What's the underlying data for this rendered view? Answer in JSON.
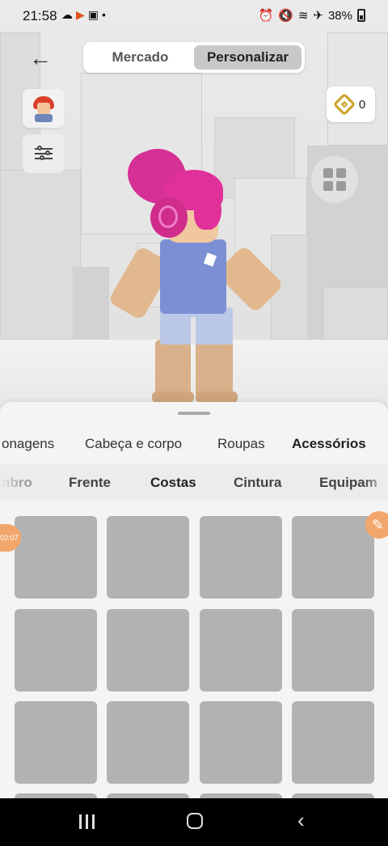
{
  "status": {
    "time": "21:58",
    "left_icons": [
      "cloud-icon",
      "video-icon",
      "image-icon",
      "dot-icon"
    ],
    "right_icons": [
      "alarm-icon",
      "mute-icon",
      "wifi-icon",
      "airplane-icon"
    ],
    "battery": "38%"
  },
  "header": {
    "back_label": "←",
    "segments": [
      {
        "label": "Mercado",
        "active": false
      },
      {
        "label": "Personalizar",
        "active": true
      }
    ]
  },
  "robux": {
    "count": "0"
  },
  "tabs": [
    {
      "label": "onagens",
      "active": false
    },
    {
      "label": "Cabeça e corpo",
      "active": false
    },
    {
      "label": "Roupas",
      "active": false
    },
    {
      "label": "Acessórios",
      "active": true
    }
  ],
  "subtabs": [
    {
      "label": "nbro",
      "active": false
    },
    {
      "label": "Frente",
      "active": false
    },
    {
      "label": "Costas",
      "active": true
    },
    {
      "label": "Cintura",
      "active": false
    },
    {
      "label": "Equipam",
      "active": false
    }
  ],
  "timer_badge": "02:07",
  "edit_icon": "brush-icon",
  "grid": {
    "rows": 3,
    "columns": 4,
    "item_state": "loading-placeholder"
  },
  "colors": {
    "tile": "#b2b2b2",
    "accent_orange": "#f3a66c",
    "hair_pink": "#e0309a",
    "shirt_blue": "#7d8fd4",
    "robux_gold": "#c9a227"
  }
}
